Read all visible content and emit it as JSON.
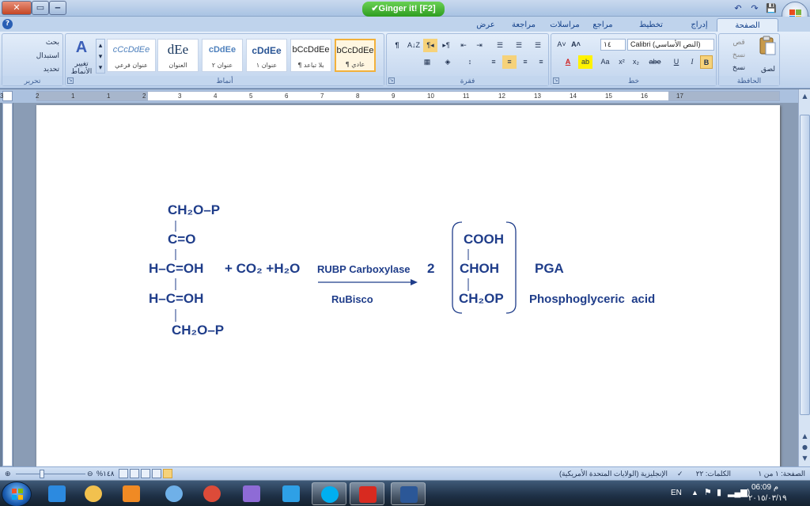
{
  "window": {
    "close_glyph": "✕",
    "restore_glyph": "▭",
    "minimize_glyph": "‒",
    "ginger_label": "✔Ginger it! [F2]"
  },
  "qat": {
    "save": "💾",
    "undo": "↶",
    "redo": "↷"
  },
  "tabs": [
    {
      "label": "الصفحة الرئيسية",
      "active": true
    },
    {
      "label": "إدراج"
    },
    {
      "label": "تخطيط الصفحة"
    },
    {
      "label": "مراجع"
    },
    {
      "label": "مراسلات"
    },
    {
      "label": "مراجعة"
    },
    {
      "label": "عرض"
    }
  ],
  "ribbon": {
    "clipboard": {
      "label": "الحافظة",
      "paste": "لصق",
      "cut": "قص",
      "copy": "نسخ",
      "format_painter": "نسخ التنسيق"
    },
    "font": {
      "label": "خط",
      "font_name": "Calibri (النص الأساسي)",
      "font_size": "١٤",
      "bold": "B",
      "italic": "I",
      "underline": "U",
      "strike": "abe",
      "subscript": "x₂",
      "superscript": "x²",
      "change_case": "Aa",
      "grow": "A˄",
      "shrink": "A˅",
      "highlight": "ab",
      "font_color": "A"
    },
    "paragraph": {
      "label": "فقرة",
      "pilcrow": "¶",
      "sort": "A↓Z"
    },
    "styles": {
      "label": "أنماط",
      "tiles": [
        {
          "sample": "bCcDdEe",
          "name": "¶ عادي",
          "selected": true
        },
        {
          "sample": "bCcDdEe",
          "name": "¶ بلا تباعد"
        },
        {
          "sample": "cDdEe",
          "name": "عنوان ١"
        },
        {
          "sample": "cDdEe",
          "name": "عنوان ٢"
        },
        {
          "sample": "dEe",
          "name": "العنوان"
        },
        {
          "sample": "cCcDdEe",
          "name": "عنوان فرعي"
        }
      ],
      "change_styles": "تغيير الأنماط"
    },
    "editing": {
      "label": "تحرير",
      "find": "بحث",
      "replace": "استبدال",
      "select": "تحديد"
    }
  },
  "ruler": {
    "numbers": [
      "17",
      "16",
      "15",
      "14",
      "13",
      "12",
      "11",
      "10",
      "9",
      "8",
      "7",
      "6",
      "5",
      "4",
      "3",
      "2",
      "1",
      "1",
      "2",
      "3"
    ]
  },
  "document": {
    "reactant": {
      "line1": "CH₂O–P",
      "line2": "C=O",
      "line3": "H–C=OH",
      "line4": "H–C=OH",
      "line5": "CH₂O–P"
    },
    "plus_co2": "+ CO₂ +H₂O",
    "enzyme_top": "RUBP Carboxylase",
    "enzyme_bottom": "RuBisco",
    "coefficient": "2",
    "product": {
      "line1": "COOH",
      "line2": "CHOH",
      "line3": "CH₂OP"
    },
    "product_abbrev": "PGA",
    "product_name": "Phosphoglyceric  acid",
    "text_color": "#1f3d8a"
  },
  "statusbar": {
    "page": "الصفحة: ١ من ١",
    "words": "الكلمات: ٢٢",
    "language": "الإنجليزية (الولايات المتحدة الأمريكية)",
    "zoom": "%١٤٨"
  },
  "taskbar": {
    "apps": [
      {
        "name": "internet-explorer-icon",
        "color": "#2c8ae0"
      },
      {
        "name": "file-explorer-icon",
        "color": "#f2c14e"
      },
      {
        "name": "media-player-icon",
        "color": "#f08a24"
      },
      {
        "name": "browser-icon",
        "color": "#6fb0e8"
      },
      {
        "name": "chrome-icon",
        "color": "#dd4b39"
      },
      {
        "name": "visual-studio-icon",
        "color": "#8e6bd6"
      },
      {
        "name": "apps-grid-icon",
        "color": "#2ea0e6"
      },
      {
        "name": "skype-icon",
        "color": "#00aff0"
      },
      {
        "name": "pdf-reader-icon",
        "color": "#d82a20"
      },
      {
        "name": "word-icon",
        "color": "#2b5797"
      }
    ],
    "language": "EN",
    "time": "06:09 م",
    "date": "٢٠١٥/٠٣/١٩"
  }
}
